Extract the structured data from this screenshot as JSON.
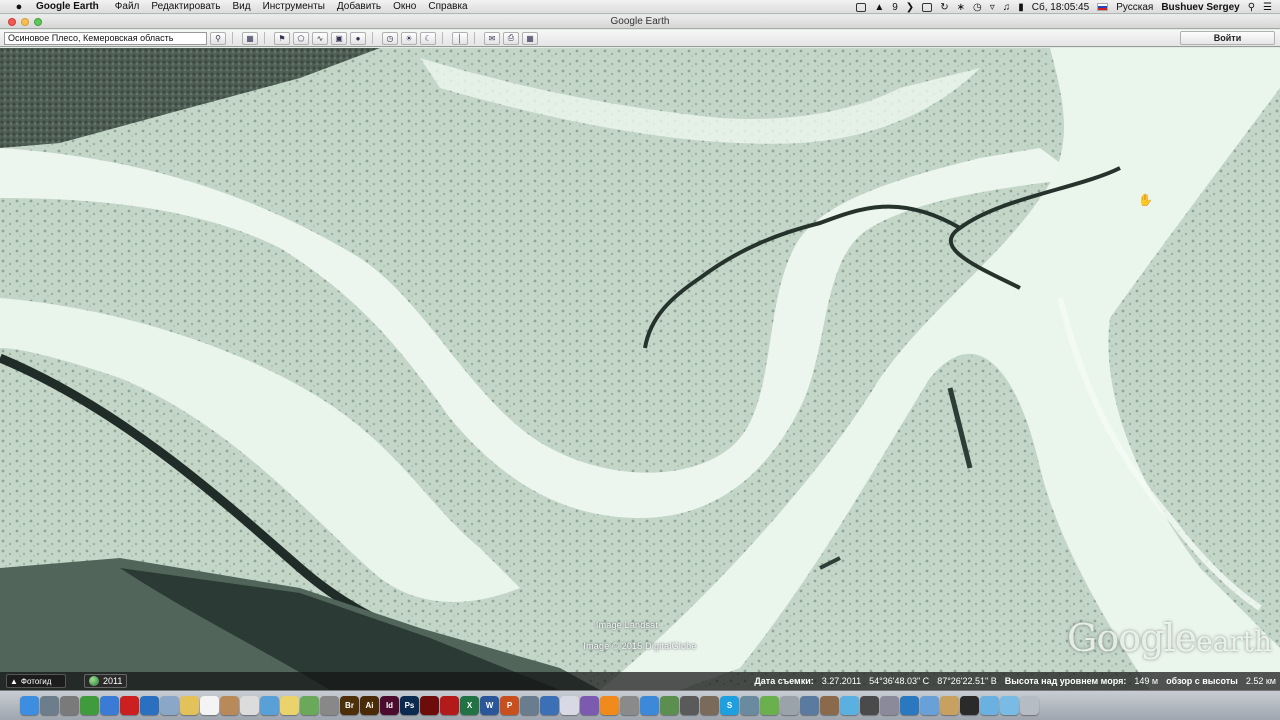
{
  "menubar": {
    "app_name": "Google Earth",
    "menus": [
      "Файл",
      "Редактировать",
      "Вид",
      "Инструменты",
      "Добавить",
      "Окно",
      "Справка"
    ],
    "status_9": "9",
    "clock": "Сб, 18:05:45",
    "keyboard_layout": "Русская",
    "user": "Bushuev Sergey"
  },
  "window": {
    "title": "Google Earth"
  },
  "toolbar": {
    "search_value": "Осиновое Плесо, Кемеровская область",
    "login_label": "Войти",
    "buttons": [
      "search-icon",
      "sidebar-icon",
      "placemark-icon",
      "polygon-icon",
      "path-icon",
      "overlay-icon",
      "record-tour-icon",
      "historical-imagery-icon",
      "sun-icon",
      "planets-icon",
      "ruler-icon",
      "email-icon",
      "print-icon",
      "maps-icon"
    ]
  },
  "map": {
    "attribution_landsat": "Image Landsat",
    "attribution_digitalglobe": "Image © 2015 DigitalGlobe",
    "logo_google": "Google",
    "logo_earth": "earth"
  },
  "statusbar": {
    "tour_guide": "Фотогид",
    "imagery_year": "2011",
    "date_label": "Дата съемки:",
    "date_value": "3.27.2011",
    "lat": "54°36'48.03\" С",
    "lon": "87°26'22.51\" В",
    "elev_label": "Высота над уровнем моря:",
    "elev_value": "149 м",
    "eye_label": "обзор с высоты",
    "eye_value": "2.52 км"
  },
  "dock": {
    "icons": [
      {
        "name": "finder-icon",
        "color": "#3d8ee0",
        "glyph": ""
      },
      {
        "name": "launchpad-icon",
        "color": "#6d7d8c",
        "glyph": ""
      },
      {
        "name": "screenshot-icon",
        "color": "#7a7a7a",
        "glyph": ""
      },
      {
        "name": "chrome-icon",
        "color": "#3f9b3b",
        "glyph": ""
      },
      {
        "name": "safari-icon",
        "color": "#3a7bd5",
        "glyph": ""
      },
      {
        "name": "opera-icon",
        "color": "#cc1f1f",
        "glyph": ""
      },
      {
        "name": "globe-browser-icon",
        "color": "#2a6fc0",
        "glyph": ""
      },
      {
        "name": "preview-icon",
        "color": "#8aa7c7",
        "glyph": ""
      },
      {
        "name": "notes-icon",
        "color": "#e4c25a",
        "glyph": ""
      },
      {
        "name": "calendar-icon",
        "color": "#f4f4f4",
        "glyph": ""
      },
      {
        "name": "contacts-icon",
        "color": "#b88a5a",
        "glyph": ""
      },
      {
        "name": "textedit-icon",
        "color": "#dcdcdc",
        "glyph": ""
      },
      {
        "name": "photos-icon",
        "color": "#5aa0d8",
        "glyph": ""
      },
      {
        "name": "stickies-icon",
        "color": "#e9d36a",
        "glyph": ""
      },
      {
        "name": "maps-icon",
        "color": "#6aa95a",
        "glyph": ""
      },
      {
        "name": "scripts-icon",
        "color": "#888888",
        "glyph": ""
      },
      {
        "name": "bridge-icon",
        "color": "#4d2f08",
        "glyph": "Br"
      },
      {
        "name": "illustrator-icon",
        "color": "#4a2a07",
        "glyph": "Ai"
      },
      {
        "name": "indesign-icon",
        "color": "#4b0a2e",
        "glyph": "Id"
      },
      {
        "name": "photoshop-icon",
        "color": "#0b2a4f",
        "glyph": "Ps"
      },
      {
        "name": "flash-icon",
        "color": "#6e0b0b",
        "glyph": ""
      },
      {
        "name": "acrobat-icon",
        "color": "#b31b1b",
        "glyph": ""
      },
      {
        "name": "excel-icon",
        "color": "#217346",
        "glyph": "X"
      },
      {
        "name": "word-icon",
        "color": "#2b579a",
        "glyph": "W"
      },
      {
        "name": "powerpoint-icon",
        "color": "#c8501f",
        "glyph": "P"
      },
      {
        "name": "image-capture-icon",
        "color": "#6a7d8f",
        "glyph": ""
      },
      {
        "name": "keynote-icon",
        "color": "#3b6fb6",
        "glyph": ""
      },
      {
        "name": "itunes-icon",
        "color": "#d9d9e6",
        "glyph": ""
      },
      {
        "name": "imovie-icon",
        "color": "#7b5ab0",
        "glyph": ""
      },
      {
        "name": "vlc-icon",
        "color": "#f08a1c",
        "glyph": ""
      },
      {
        "name": "preferences-icon",
        "color": "#8a8a8a",
        "glyph": ""
      },
      {
        "name": "app-store-icon",
        "color": "#3d89d9",
        "glyph": ""
      },
      {
        "name": "grapher-icon",
        "color": "#5c8f4f",
        "glyph": ""
      },
      {
        "name": "calculator-icon",
        "color": "#5a5a5a",
        "glyph": ""
      },
      {
        "name": "chess-icon",
        "color": "#7a6a5a",
        "glyph": ""
      },
      {
        "name": "skype-icon",
        "color": "#1e9fe0",
        "glyph": "S"
      },
      {
        "name": "growl-icon",
        "color": "#6a8aa0",
        "glyph": ""
      },
      {
        "name": "utorrent-icon",
        "color": "#6ab04c",
        "glyph": ""
      },
      {
        "name": "disk-utility-icon",
        "color": "#9aa2aa",
        "glyph": ""
      },
      {
        "name": "system-info-icon",
        "color": "#5a7aa0",
        "glyph": ""
      },
      {
        "name": "dictionary-icon",
        "color": "#8a6a4a",
        "glyph": ""
      },
      {
        "name": "messages-icon",
        "color": "#5ab0e0",
        "glyph": ""
      },
      {
        "name": "camera-icon",
        "color": "#4a4a4a",
        "glyph": ""
      },
      {
        "name": "automator-icon",
        "color": "#8a8a9a",
        "glyph": ""
      },
      {
        "name": "google-earth-icon",
        "color": "#2a78c0",
        "glyph": ""
      },
      {
        "name": "mail-icon",
        "color": "#6aa0d8",
        "glyph": ""
      },
      {
        "name": "reader-icon",
        "color": "#c8a060",
        "glyph": ""
      },
      {
        "name": "terminal-icon",
        "color": "#2a2a2a",
        "glyph": ""
      },
      {
        "name": "downloads-folder-icon",
        "color": "#6ab0e0",
        "glyph": ""
      },
      {
        "name": "documents-folder-icon",
        "color": "#7abbe5",
        "glyph": ""
      },
      {
        "name": "trash-icon",
        "color": "#b5bcc3",
        "glyph": ""
      }
    ]
  }
}
